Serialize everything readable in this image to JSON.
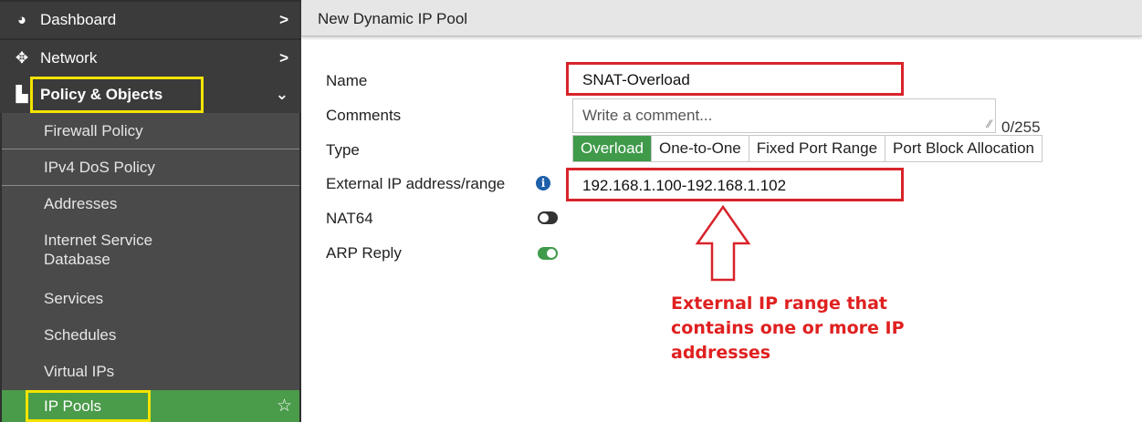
{
  "sidebar": {
    "items": [
      {
        "label": "Dashboard",
        "icon": "dashboard-icon",
        "chevron": ">"
      },
      {
        "label": "Network",
        "icon": "network-move-icon",
        "chevron": ">"
      },
      {
        "label": "Policy & Objects",
        "icon": "policy-objects-icon",
        "chevron": "⌄"
      }
    ],
    "sub_items": [
      {
        "label": "Firewall Policy"
      },
      {
        "label": "IPv4 DoS Policy"
      },
      {
        "label": "Addresses"
      },
      {
        "label": "Internet Service Database"
      },
      {
        "label": "Services"
      },
      {
        "label": "Schedules"
      },
      {
        "label": "Virtual IPs"
      },
      {
        "label": "IP Pools"
      }
    ],
    "favorite_icon": "star-outline-icon"
  },
  "header": {
    "title": "New Dynamic IP Pool"
  },
  "form": {
    "name_label": "Name",
    "name_value": "SNAT-Overload",
    "comments_label": "Comments",
    "comments_placeholder": "Write a comment...",
    "comments_count": "0/255",
    "type_label": "Type",
    "type_options": [
      "Overload",
      "One-to-One",
      "Fixed Port Range",
      "Port Block Allocation"
    ],
    "type_selected": "Overload",
    "external_ip_label": "External IP address/range",
    "external_ip_value": "192.168.1.100-192.168.1.102",
    "nat64_label": "NAT64",
    "nat64_enabled": false,
    "arp_reply_label": "ARP Reply",
    "arp_reply_enabled": true
  },
  "annotation": {
    "text": "External IP range that contains one or more IP addresses",
    "color": "#e02020"
  },
  "colors": {
    "sidebar_bg": "#2f2f2f",
    "active_green": "#4a9b4a",
    "highlight_yellow": "#f4e400",
    "highlight_red": "#d8232a"
  }
}
